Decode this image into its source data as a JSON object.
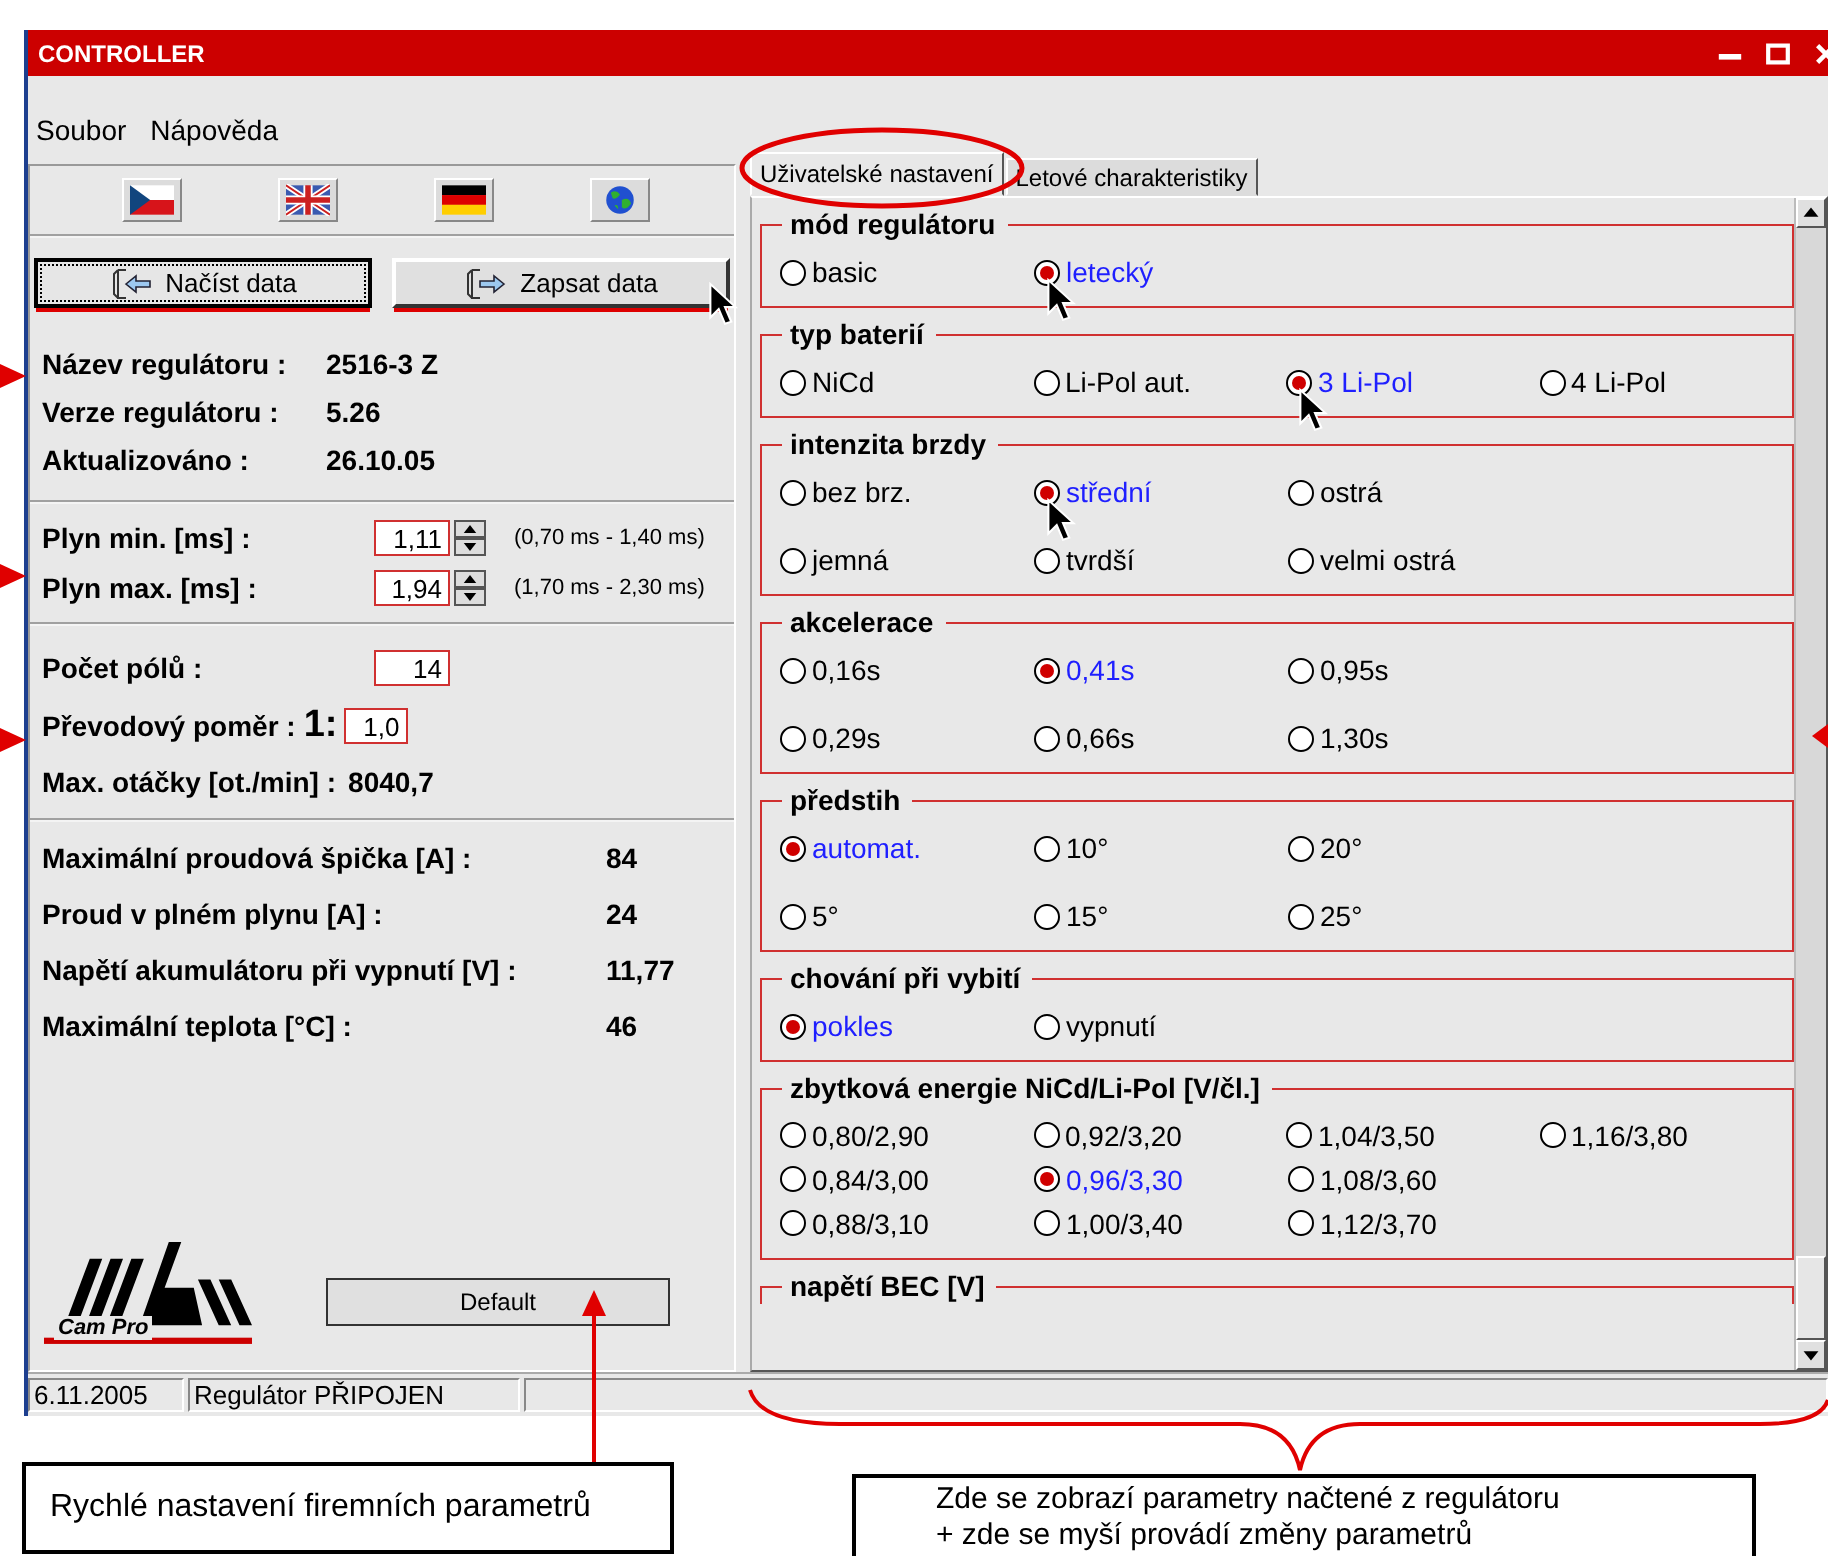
{
  "window": {
    "title": "CONTROLLER"
  },
  "menu": [
    {
      "label": "Soubor"
    },
    {
      "label": "Nápověda"
    }
  ],
  "languages": [
    {
      "kind": "czech"
    },
    {
      "kind": "british"
    },
    {
      "kind": "german"
    },
    {
      "kind": "globe"
    }
  ],
  "data_buttons": [
    {
      "label": "Načíst data",
      "kind": "load",
      "focused": true,
      "pointer": false
    },
    {
      "label": "Zapsat data",
      "kind": "save",
      "focused": false,
      "pointer": true
    }
  ],
  "device_info": [
    {
      "label": "Název regulátoru :",
      "value": "2516-3 Z"
    },
    {
      "label": "Verze regulátoru :",
      "value": "5.26"
    },
    {
      "label": "Aktualizováno :",
      "value": "26.10.05"
    }
  ],
  "throttle": [
    {
      "label": "Plyn min. [ms] :",
      "value": "1,11",
      "range": "(0,70 ms - 1,40 ms)"
    },
    {
      "label": "Plyn max. [ms] :",
      "value": "1,94",
      "range": "(1,70 ms - 2,30 ms)"
    }
  ],
  "motor": {
    "poles": {
      "label": "Počet pólů :",
      "value": "14"
    },
    "ratio": {
      "label": "Převodový poměr :",
      "prefix": "1:",
      "value": "1,0"
    },
    "rpm": {
      "label": "Max. otáčky [ot./min] :",
      "value": "8040,7"
    }
  },
  "stats": [
    {
      "label": "Maximální proudová špička [A] :",
      "value": "84"
    },
    {
      "label": "Proud v plném plynu [A] :",
      "value": "24"
    },
    {
      "label": "Napětí akumulátoru při vypnutí [V] :",
      "value": "11,77"
    },
    {
      "label": "Maximální teplota [°C] :",
      "value": "46"
    }
  ],
  "logo": {
    "text": "Cam Pro"
  },
  "default_button": {
    "label": "Default"
  },
  "tabs": [
    {
      "label": "Uživatelské nastavení",
      "selected": true
    },
    {
      "label": "Letové charakteristiky",
      "selected": false
    }
  ],
  "groups": [
    {
      "title": "mód regulátoru",
      "rows": [
        [
          {
            "label": "basic",
            "selected": false,
            "pointer": false
          },
          {
            "label": "letecký",
            "selected": true,
            "pointer": true
          }
        ]
      ]
    },
    {
      "title": "typ baterií",
      "rows": [
        [
          {
            "label": "NiCd",
            "selected": false,
            "pointer": false
          },
          {
            "label": "Li-Pol aut.",
            "selected": false,
            "pointer": false
          },
          {
            "label": "3 Li-Pol",
            "selected": true,
            "pointer": true
          },
          {
            "label": "4 Li-Pol",
            "selected": false,
            "pointer": false
          }
        ]
      ]
    },
    {
      "title": "intenzita brzdy",
      "rows": [
        [
          {
            "label": "bez brz.",
            "selected": false,
            "pointer": false
          },
          {
            "label": "střední",
            "selected": true,
            "pointer": true
          },
          {
            "label": "ostrá",
            "selected": false,
            "pointer": false
          }
        ],
        [
          {
            "label": "jemná",
            "selected": false,
            "pointer": false
          },
          {
            "label": "tvrdší",
            "selected": false,
            "pointer": false
          },
          {
            "label": "velmi ostrá",
            "selected": false,
            "pointer": false
          }
        ]
      ]
    },
    {
      "title": "akcelerace",
      "rows": [
        [
          {
            "label": "0,16s",
            "selected": false,
            "pointer": false
          },
          {
            "label": "0,41s",
            "selected": true,
            "pointer": false
          },
          {
            "label": "0,95s",
            "selected": false,
            "pointer": false
          }
        ],
        [
          {
            "label": "0,29s",
            "selected": false,
            "pointer": false
          },
          {
            "label": "0,66s",
            "selected": false,
            "pointer": false
          },
          {
            "label": "1,30s",
            "selected": false,
            "pointer": false
          }
        ]
      ]
    },
    {
      "title": "předstih",
      "rows": [
        [
          {
            "label": "automat.",
            "selected": true,
            "pointer": false
          },
          {
            "label": "10°",
            "selected": false,
            "pointer": false
          },
          {
            "label": "20°",
            "selected": false,
            "pointer": false
          }
        ],
        [
          {
            "label": "5°",
            "selected": false,
            "pointer": false
          },
          {
            "label": "15°",
            "selected": false,
            "pointer": false
          },
          {
            "label": "25°",
            "selected": false,
            "pointer": false
          }
        ]
      ]
    },
    {
      "title": "chování při vybití",
      "rows": [
        [
          {
            "label": "pokles",
            "selected": true,
            "pointer": false
          },
          {
            "label": "vypnutí",
            "selected": false,
            "pointer": false
          }
        ]
      ]
    },
    {
      "title": "zbytková energie NiCd/Li-Pol [V/čl.]",
      "rows": [
        [
          {
            "label": "0,80/2,90",
            "selected": false,
            "pointer": false
          },
          {
            "label": "0,92/3,20",
            "selected": false,
            "pointer": false
          },
          {
            "label": "1,04/3,50",
            "selected": false,
            "pointer": false
          },
          {
            "label": "1,16/3,80",
            "selected": false,
            "pointer": false
          }
        ],
        [
          {
            "label": "0,84/3,00",
            "selected": false,
            "pointer": false
          },
          {
            "label": "0,96/3,30",
            "selected": true,
            "pointer": false
          },
          {
            "label": "1,08/3,60",
            "selected": false,
            "pointer": false
          }
        ],
        [
          {
            "label": "0,88/3,10",
            "selected": false,
            "pointer": false
          },
          {
            "label": "1,00/3,40",
            "selected": false,
            "pointer": false
          },
          {
            "label": "1,12/3,70",
            "selected": false,
            "pointer": false
          }
        ]
      ]
    },
    {
      "title": "napětí BEC [V]"
    }
  ],
  "status_bar": [
    "6.11.2005",
    "Regulátor PŘIPOJEN"
  ],
  "callouts": [
    {
      "lines": [
        "Rychlé nastavení firemních parametrů"
      ]
    },
    {
      "lines": [
        "Zde se zobrazí parametry načtené z regulátoru",
        "+ zde se myší provádí změny parametrů"
      ]
    }
  ]
}
